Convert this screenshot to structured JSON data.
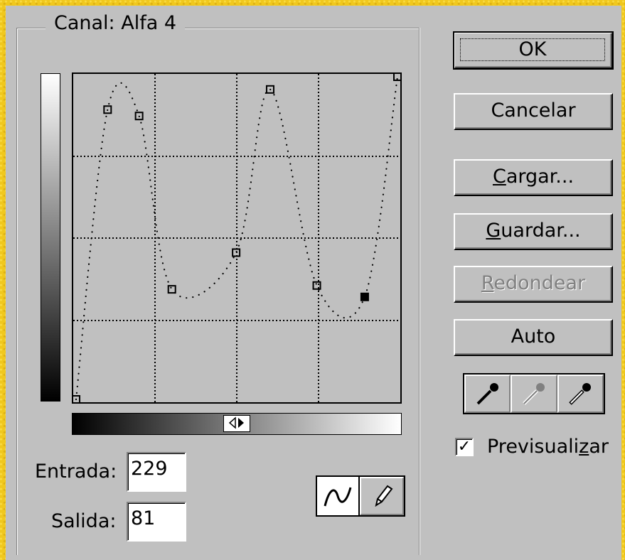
{
  "dialog": {
    "channel_label": "Canal:  Alfa 4"
  },
  "inputs": {
    "entrada_label": "Entrada:",
    "entrada_value": "229",
    "salida_label": "Salida:",
    "salida_value": "81"
  },
  "buttons": {
    "ok": "OK",
    "cancelar": "Cancelar",
    "cargar_mnemonic": "C",
    "cargar_rest": "argar...",
    "guardar_mnemonic": "G",
    "guardar_rest": "uardar...",
    "redondear_mnemonic": "R",
    "redondear_rest": "edondear",
    "auto": "Auto"
  },
  "preview": {
    "label_before": "Previsuali",
    "label_mnemonic": "z",
    "label_after": "ar",
    "checked": true,
    "check_mark": "✓"
  },
  "icons": {
    "black_eyedropper": "black-eyedropper-icon",
    "gray_eyedropper": "gray-eyedropper-icon",
    "white_eyedropper": "white-eyedropper-icon",
    "curve_tool": "curve-icon",
    "pencil_tool": "pencil-icon"
  },
  "curve": {
    "grid_divisions": 4,
    "control_points": [
      {
        "input": 25,
        "output": 229,
        "selected": false
      },
      {
        "input": 50,
        "output": 224,
        "selected": false
      },
      {
        "input": 76,
        "output": 87,
        "selected": false
      },
      {
        "input": 127,
        "output": 116,
        "selected": false
      },
      {
        "input": 154,
        "output": 245,
        "selected": false
      },
      {
        "input": 191,
        "output": 90,
        "selected": false
      },
      {
        "input": 229,
        "output": 81,
        "selected": true
      },
      {
        "input": 255,
        "output": 255,
        "selected": false
      },
      {
        "input": 0,
        "output": 0,
        "selected": false
      }
    ]
  }
}
